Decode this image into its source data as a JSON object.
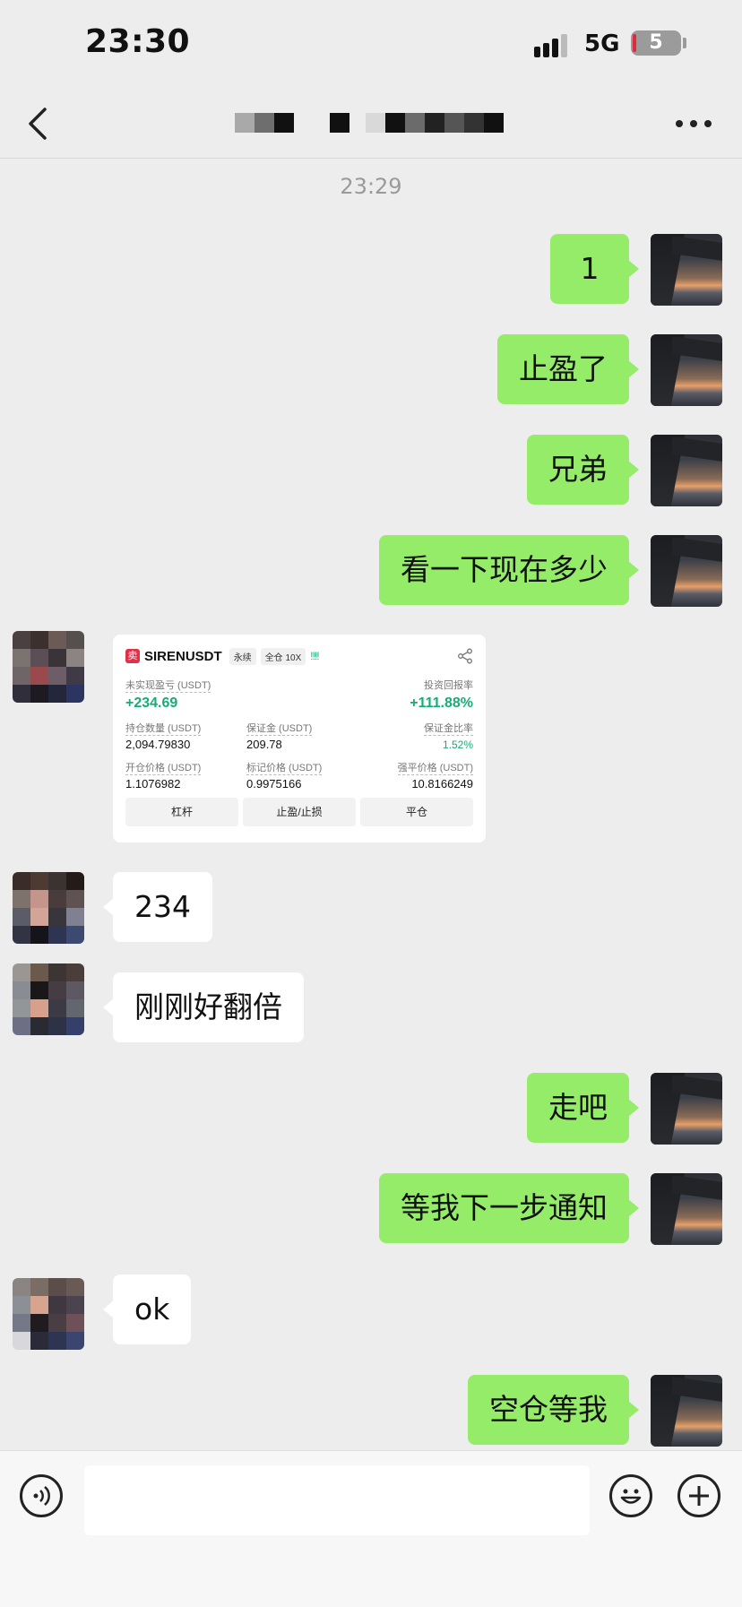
{
  "status": {
    "time": "23:30",
    "network": "5G",
    "battery": "5"
  },
  "nav": {
    "title": ""
  },
  "timestamp": "23:29",
  "messages": [
    {
      "side": "right",
      "text": "1"
    },
    {
      "side": "right",
      "text": "止盈了"
    },
    {
      "side": "right",
      "text": "兄弟"
    },
    {
      "side": "right",
      "text": "看一下现在多少"
    },
    {
      "side": "left",
      "type": "card"
    },
    {
      "side": "left",
      "text": "234"
    },
    {
      "side": "left",
      "text": "刚刚好翻倍"
    },
    {
      "side": "right",
      "text": "走吧"
    },
    {
      "side": "right",
      "text": "等我下一步通知"
    },
    {
      "side": "left",
      "text": "ok"
    },
    {
      "side": "right",
      "text": "空仓等我"
    }
  ],
  "card": {
    "logo": "卖",
    "symbol": "SIRENUSDT",
    "tag_perpetual": "永续",
    "tag_margin": "全仓 10X",
    "bars": "!!!!",
    "unrealized_label": "未实现盈亏 (USDT)",
    "unrealized_value": "+234.69",
    "roi_label": "投资回报率",
    "roi_value": "+111.88%",
    "position_label": "持仓数量 (USDT)",
    "position_value": "2,094.79830",
    "margin_label": "保证金 (USDT)",
    "margin_value": "209.78",
    "margin_ratio_label": "保证金比率",
    "margin_ratio_value": "1.52%",
    "entry_label": "开仓价格 (USDT)",
    "entry_value": "1.1076982",
    "mark_label": "标记价格 (USDT)",
    "mark_value": "0.9975166",
    "liq_label": "强平价格 (USDT)",
    "liq_value": "10.8166249",
    "btn_leverage": "杠杆",
    "btn_tpsl": "止盈/止损",
    "btn_close": "平仓"
  },
  "colors": {
    "my_bubble": "#95ec69",
    "profit_green": "#1aaa76",
    "background": "#ededed"
  },
  "icons": [
    "back-arrow-icon",
    "more-icon",
    "voice-icon",
    "emoji-icon",
    "plus-icon",
    "share-icon"
  ]
}
